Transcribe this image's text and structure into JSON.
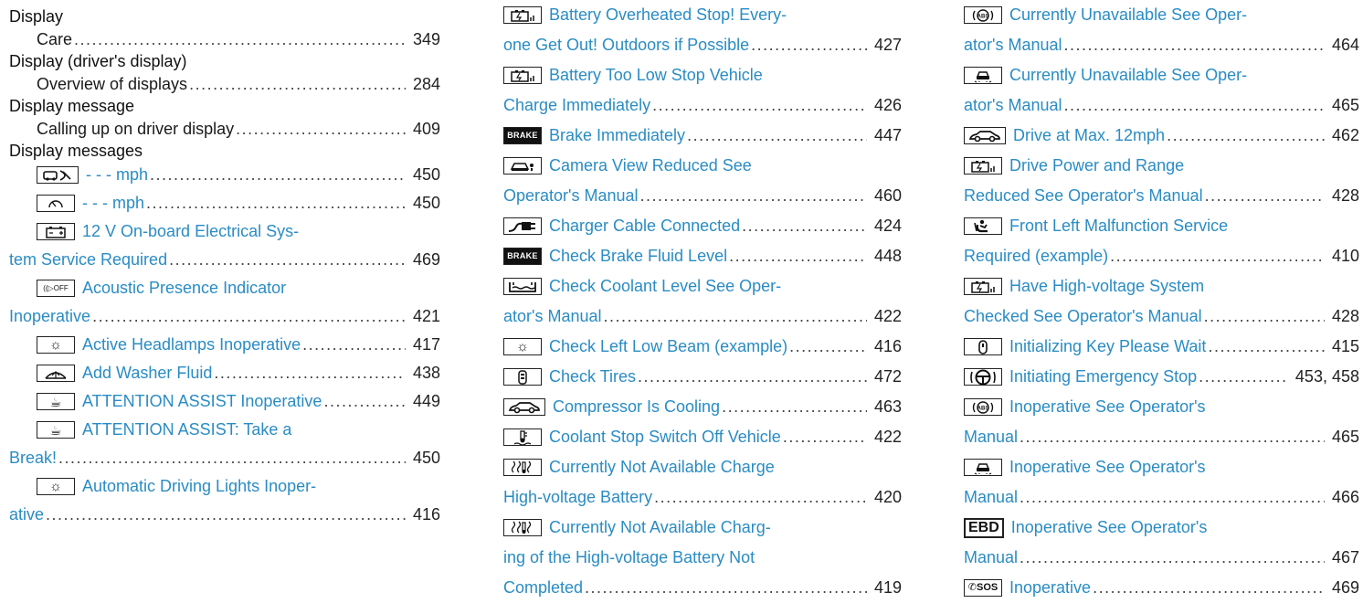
{
  "columns": [
    {
      "entries": [
        {
          "kind": "heading",
          "text": "Display"
        },
        {
          "kind": "sub",
          "text": "Care",
          "page": "349"
        },
        {
          "kind": "heading",
          "text": "Display (driver's display)"
        },
        {
          "kind": "sub",
          "text": "Overview of displays",
          "page": "284"
        },
        {
          "kind": "heading",
          "text": "Display message"
        },
        {
          "kind": "sub",
          "text": "Calling up on driver display",
          "page": "409"
        },
        {
          "kind": "heading",
          "text": "Display messages"
        },
        {
          "kind": "msg",
          "icon": "driver-distance-icon",
          "icon_text": "",
          "lines": [
            "- - - mph"
          ],
          "page": "450"
        },
        {
          "kind": "msg",
          "icon": "speedometer-icon",
          "icon_text": "",
          "lines": [
            "- - - mph"
          ],
          "page": "450"
        },
        {
          "kind": "msg",
          "icon": "battery-icon",
          "icon_text": "",
          "lines": [
            "12 V On-board Electrical Sys-",
            "tem Service Required"
          ],
          "page": "469"
        },
        {
          "kind": "msg",
          "icon": "acoustic-off-icon",
          "icon_text": "((▷OFF",
          "lines": [
            "Acoustic Presence Indicator",
            "Inoperative"
          ],
          "page": "421"
        },
        {
          "kind": "msg",
          "icon": "headlamp-icon",
          "icon_text": "☼",
          "lines": [
            "Active Headlamps Inoperative"
          ],
          "page": "417"
        },
        {
          "kind": "msg",
          "icon": "washer-fluid-icon",
          "icon_text": "",
          "lines": [
            "Add Washer Fluid"
          ],
          "page": "438"
        },
        {
          "kind": "msg",
          "icon": "coffee-cup-icon",
          "icon_text": "☕",
          "lines": [
            "ATTENTION ASSIST Inoperative"
          ],
          "page": "449"
        },
        {
          "kind": "msg",
          "icon": "coffee-cup-icon",
          "icon_text": "☕",
          "lines": [
            "ATTENTION ASSIST: Take a",
            "Break!"
          ],
          "page": "450"
        },
        {
          "kind": "msg",
          "icon": "headlamp-icon",
          "icon_text": "☼",
          "lines": [
            "Automatic Driving Lights Inoper-",
            "ative"
          ],
          "page": "416"
        }
      ]
    },
    {
      "entries": [
        {
          "kind": "msg",
          "icon": "hv-battery-icon",
          "icon_text": "",
          "lines": [
            "Battery Overheated Stop! Every-",
            "one Get Out! Outdoors if Possible"
          ],
          "page": "427"
        },
        {
          "kind": "msg",
          "icon": "hv-battery-icon",
          "icon_text": "",
          "lines": [
            "Battery Too Low Stop Vehicle",
            "Charge Immediately"
          ],
          "page": "426"
        },
        {
          "kind": "msg",
          "icon": "brake-icon",
          "icon_text": "BRAKE",
          "lines": [
            "Brake Immediately"
          ],
          "page": "447"
        },
        {
          "kind": "msg",
          "icon": "camera-icon",
          "icon_text": "",
          "lines": [
            "Camera View Reduced See",
            "Operator's Manual"
          ],
          "page": "460"
        },
        {
          "kind": "msg",
          "icon": "charger-plug-icon",
          "icon_text": "",
          "lines": [
            "Charger Cable Connected"
          ],
          "page": "424"
        },
        {
          "kind": "msg",
          "icon": "brake-icon",
          "icon_text": "BRAKE",
          "lines": [
            "Check Brake Fluid Level"
          ],
          "page": "448"
        },
        {
          "kind": "msg",
          "icon": "coolant-level-icon",
          "icon_text": "",
          "lines": [
            "Check Coolant Level See Oper-",
            "ator's Manual"
          ],
          "page": "422"
        },
        {
          "kind": "msg",
          "icon": "headlamp-icon",
          "icon_text": "☼",
          "lines": [
            "Check Left Low Beam (example)"
          ],
          "page": "416"
        },
        {
          "kind": "msg",
          "icon": "tire-icon",
          "icon_text": "",
          "lines": [
            "Check Tires"
          ],
          "page": "472"
        },
        {
          "kind": "msg",
          "icon": "car-icon",
          "icon_text": "",
          "lines": [
            "Compressor Is Cooling"
          ],
          "page": "463"
        },
        {
          "kind": "msg",
          "icon": "coolant-temp-icon",
          "icon_text": "",
          "lines": [
            "Coolant Stop Switch Off Vehicle"
          ],
          "page": "422"
        },
        {
          "kind": "msg",
          "icon": "hv-battery-temp-icon",
          "icon_text": "",
          "lines": [
            "Currently Not Available Charge",
            "High-voltage Battery"
          ],
          "page": "420"
        },
        {
          "kind": "msg",
          "icon": "hv-battery-temp-icon",
          "icon_text": "",
          "lines": [
            "Currently Not Available Charg-",
            "ing of the High-voltage Battery Not",
            "Completed"
          ],
          "page": "419"
        }
      ]
    },
    {
      "entries": [
        {
          "kind": "msg",
          "icon": "abs-icon",
          "icon_text": "",
          "lines": [
            "Currently Unavailable See Oper-",
            "ator's Manual"
          ],
          "page": "464"
        },
        {
          "kind": "msg",
          "icon": "lane-car-icon",
          "icon_text": "",
          "lines": [
            "Currently Unavailable See Oper-",
            "ator's Manual"
          ],
          "page": "465"
        },
        {
          "kind": "msg",
          "icon": "car-icon",
          "icon_text": "",
          "lines": [
            "Drive at Max. 12mph"
          ],
          "page": "462"
        },
        {
          "kind": "msg",
          "icon": "hv-battery-icon",
          "icon_text": "",
          "lines": [
            "Drive Power and Range",
            "Reduced See Operator's Manual"
          ],
          "page": "428"
        },
        {
          "kind": "msg",
          "icon": "seat-person-icon",
          "icon_text": "",
          "lines": [
            "Front Left Malfunction Service",
            "Required (example)"
          ],
          "page": "410"
        },
        {
          "kind": "msg",
          "icon": "hv-battery-icon",
          "icon_text": "",
          "lines": [
            "Have High-voltage System",
            "Checked See Operator's Manual"
          ],
          "page": "428"
        },
        {
          "kind": "msg",
          "icon": "key-icon",
          "icon_text": "",
          "lines": [
            "Initializing Key Please Wait"
          ],
          "page": "415"
        },
        {
          "kind": "msg",
          "icon": "steering-wheel-icon",
          "icon_text": "",
          "lines": [
            "Initiating Emergency Stop"
          ],
          "page": "453, 458"
        },
        {
          "kind": "msg",
          "icon": "abs-icon",
          "icon_text": "",
          "lines": [
            "Inoperative See Operator's",
            "Manual"
          ],
          "page": "465"
        },
        {
          "kind": "msg",
          "icon": "lane-car-icon",
          "icon_text": "",
          "lines": [
            "Inoperative See Operator's",
            "Manual"
          ],
          "page": "466"
        },
        {
          "kind": "msg",
          "icon": "ebd-icon",
          "icon_text": "EBD",
          "lines": [
            "Inoperative See Operator's",
            "Manual"
          ],
          "page": "467"
        },
        {
          "kind": "msg",
          "icon": "sos-icon",
          "icon_text": "✆SOS",
          "lines": [
            "Inoperative"
          ],
          "page": "469"
        }
      ]
    }
  ],
  "colors": {
    "link": "#2a8cc4",
    "text": "#1a1a1a"
  }
}
